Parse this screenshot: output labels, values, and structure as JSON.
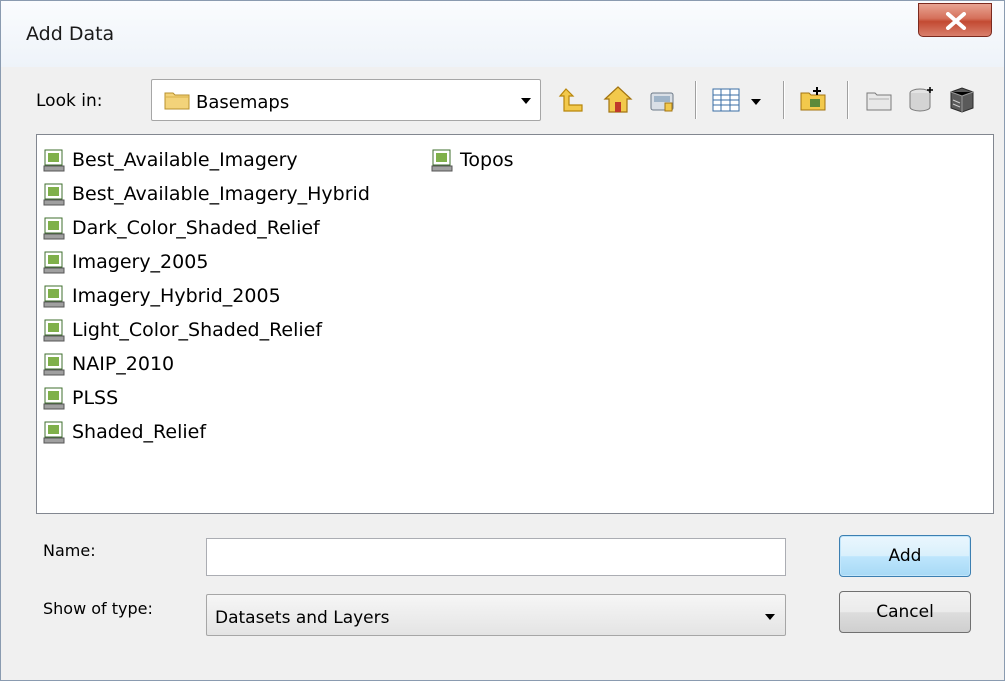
{
  "window": {
    "title": "Add Data"
  },
  "look_in": {
    "label": "Look in:",
    "value": "Basemaps"
  },
  "toolbar": {
    "icons": [
      "up-one-level-icon",
      "home-icon",
      "connect-folder-icon",
      "view-options-icon",
      "new-folder-icon",
      "new-file-geodatabase-icon",
      "new-database-icon",
      "new-server-icon"
    ]
  },
  "file_list": {
    "items": [
      {
        "name": "Best_Available_Imagery"
      },
      {
        "name": "Best_Available_Imagery_Hybrid"
      },
      {
        "name": "Dark_Color_Shaded_Relief"
      },
      {
        "name": "Imagery_2005"
      },
      {
        "name": "Imagery_Hybrid_2005"
      },
      {
        "name": "Light_Color_Shaded_Relief"
      },
      {
        "name": "NAIP_2010"
      },
      {
        "name": "PLSS"
      },
      {
        "name": "Shaded_Relief"
      },
      {
        "name": "Topos"
      }
    ]
  },
  "name_field": {
    "label": "Name:",
    "value": ""
  },
  "type_field": {
    "label": "Show of type:",
    "value": "Datasets and Layers"
  },
  "buttons": {
    "add": "Add",
    "cancel": "Cancel"
  },
  "colors": {
    "close_button": "#c94f38",
    "default_button_border": "#3c7fb1"
  }
}
